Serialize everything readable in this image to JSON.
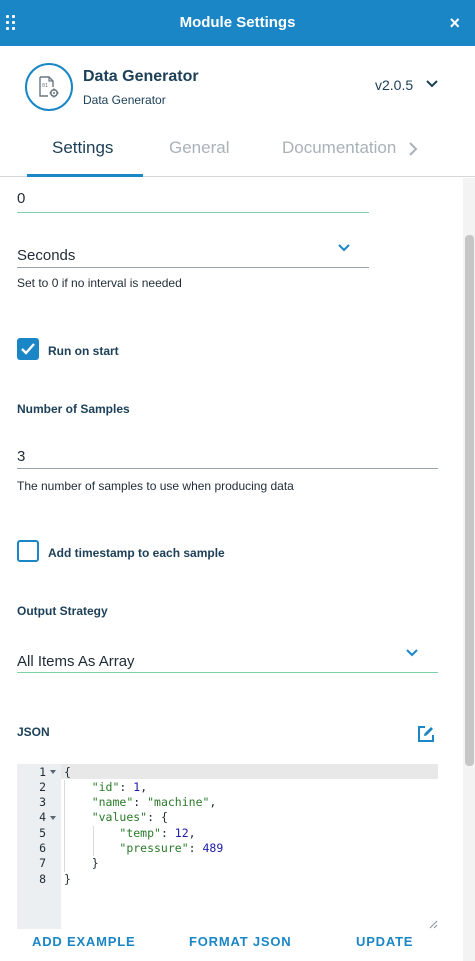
{
  "window": {
    "title": "Module Settings",
    "close_symbol": "×"
  },
  "module": {
    "name": "Data Generator",
    "subtitle": "Data Generator",
    "version": "v2.0.5"
  },
  "tabs": [
    {
      "label": "Settings",
      "active": true
    },
    {
      "label": "General",
      "active": false
    },
    {
      "label": "Documentation",
      "active": false
    }
  ],
  "form": {
    "interval_value": "0",
    "interval_unit": "Seconds",
    "interval_hint": "Set to 0 if no interval is needed",
    "run_on_start": {
      "label": "Run on start",
      "checked": true
    },
    "number_of_samples": {
      "label": "Number of Samples",
      "value": "3",
      "hint": "The number of samples to use when producing data"
    },
    "add_timestamp": {
      "label": "Add timestamp to each sample",
      "checked": false
    },
    "output_strategy": {
      "label": "Output Strategy",
      "value": "All Items As Array"
    },
    "json": {
      "label": "JSON",
      "line_numbers": [
        "1",
        "2",
        "3",
        "4",
        "5",
        "6",
        "7",
        "8"
      ],
      "lines": {
        "l1": "{",
        "l2_key": "\"id\"",
        "l2_val": "1",
        "l3_key": "\"name\"",
        "l3_val": "\"machine\"",
        "l4_key": "\"values\"",
        "l4_val": "{",
        "l5_key": "\"temp\"",
        "l5_val": "12",
        "l6_key": "\"pressure\"",
        "l6_val": "489",
        "l7": "}",
        "l8": "}"
      }
    }
  },
  "actions": {
    "add_example": "ADD EXAMPLE",
    "format_json": "FORMAT JSON",
    "update": "UPDATE"
  },
  "colors": {
    "accent": "#1a86c6",
    "header_bg": "#1a86c6",
    "text_dark": "#1d4058",
    "valid_underline": "#7fd1a6",
    "inactive_tab": "#a9b1b9"
  }
}
